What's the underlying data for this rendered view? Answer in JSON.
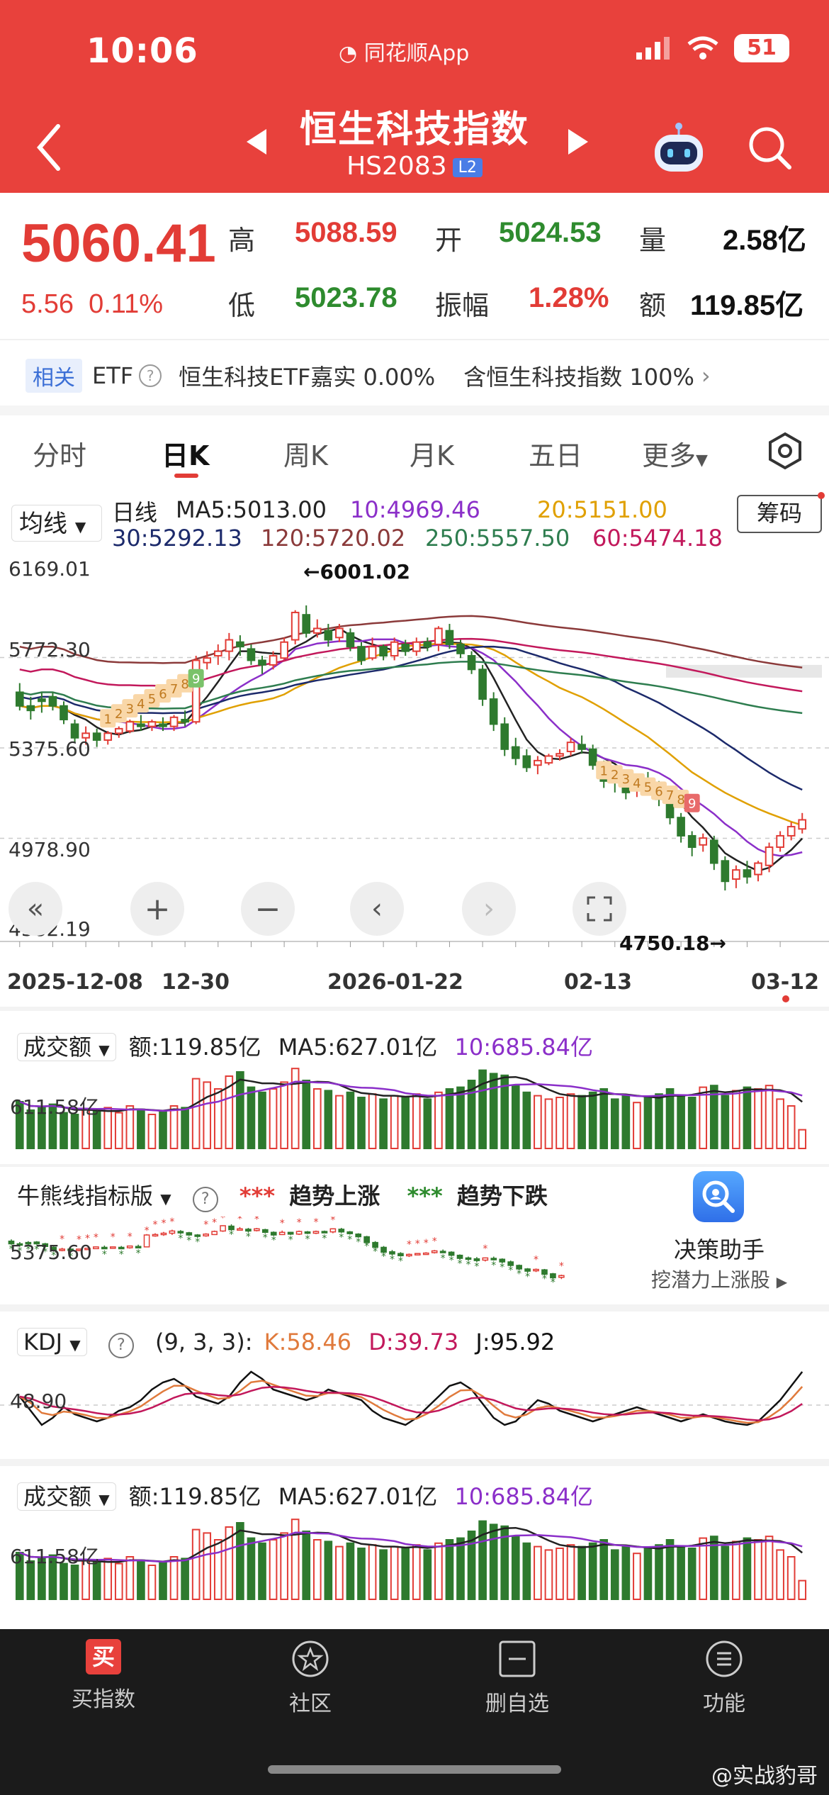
{
  "status": {
    "time": "10:06",
    "app_name": "同花顺App",
    "battery": "51"
  },
  "header": {
    "title": "恒生科技指数",
    "code": "HS2083",
    "badge": "L2"
  },
  "quote": {
    "price": "5060.41",
    "change": "5.56",
    "change_pct": "0.11%",
    "high_label": "高",
    "high": "5088.59",
    "open_label": "开",
    "open": "5024.53",
    "volume_label": "量",
    "volume": "2.58亿",
    "low_label": "低",
    "low": "5023.78",
    "amplitude_label": "振幅",
    "amplitude": "1.28%",
    "amount_label": "额",
    "amount": "119.85亿"
  },
  "related": {
    "tag": "相关",
    "etf": "ETF",
    "text": "恒生科技ETF嘉实 0.00%",
    "index_text": "含恒生科技指数 100%"
  },
  "tabs": [
    "分时",
    "日K",
    "周K",
    "月K",
    "五日",
    "更多"
  ],
  "ma": {
    "select": "均线",
    "period": "日线",
    "ma5": "MA5:5013.00",
    "ma10": "10:4969.46",
    "ma20": "20:5151.00",
    "ma30": "30:5292.13",
    "ma120": "120:5720.02",
    "ma250": "250:5557.50",
    "ma60": "60:5474.18",
    "chip_button": "筹码",
    "colors": {
      "ma5": "#222222",
      "ma10": "#8b2fc9",
      "ma20": "#e0a000",
      "ma30": "#1c2a6b",
      "ma120": "#8b3a3a",
      "ma250": "#2e7d4f",
      "ma60": "#c2185b"
    }
  },
  "price_chart": {
    "y_ticks": [
      "6169.01",
      "5772.30",
      "5375.60",
      "4978.90",
      "4582.19"
    ],
    "max_label": "←6001.02",
    "min_label": "4750.18→",
    "x_ticks": [
      "2025-12-08",
      "12-30",
      "2026-01-22",
      "02-13",
      "03-12"
    ],
    "sequence_numbers": [
      "1",
      "2",
      "3",
      "4",
      "5",
      "6",
      "7",
      "8",
      "9"
    ]
  },
  "volume_panel": {
    "select": "成交额",
    "amount": "额:119.85亿",
    "ma5": "MA5:627.01亿",
    "ma10": "10:685.84亿",
    "y_tick": "611.58亿"
  },
  "bull_bear_panel": {
    "select": "牛熊线指标版",
    "up_marker": "***",
    "up_label": "趋势上涨",
    "down_marker": "***",
    "down_label": "趋势下跌",
    "y_tick": "5375.60",
    "assistant_title": "决策助手",
    "assistant_sub": "挖潜力上涨股"
  },
  "kdj_panel": {
    "select": "KDJ",
    "params": "(9, 3, 3):",
    "k": "K:58.46",
    "d": "D:39.73",
    "j": "J:95.92",
    "y_tick": "48.90"
  },
  "volume_panel2": {
    "select": "成交额",
    "amount": "额:119.85亿",
    "ma5": "MA5:627.01亿",
    "ma10": "10:685.84亿",
    "y_tick": "611.58亿"
  },
  "nav": [
    "买指数",
    "社区",
    "删自选",
    "功能"
  ],
  "nav_icon_text": "买",
  "watermark": "@实战豹哥",
  "candles": [
    [
      5620,
      5660,
      5560,
      5540
    ],
    [
      5560,
      5600,
      5540,
      5500
    ],
    [
      5590,
      5620,
      5580,
      5530
    ],
    [
      5600,
      5620,
      5560,
      5540
    ],
    [
      5560,
      5580,
      5500,
      5480
    ],
    [
      5480,
      5500,
      5420,
      5400
    ],
    [
      5420,
      5470,
      5440,
      5390
    ],
    [
      5440,
      5460,
      5410,
      5380
    ],
    [
      5410,
      5450,
      5440,
      5390
    ],
    [
      5440,
      5470,
      5460,
      5420
    ],
    [
      5450,
      5500,
      5490,
      5440
    ],
    [
      5480,
      5520,
      5470,
      5450
    ],
    [
      5470,
      5500,
      5490,
      5450
    ],
    [
      5480,
      5510,
      5470,
      5450
    ],
    [
      5470,
      5520,
      5510,
      5450
    ],
    [
      5500,
      5540,
      5490,
      5470
    ],
    [
      5490,
      5780,
      5760,
      5480
    ],
    [
      5750,
      5800,
      5770,
      5720
    ],
    [
      5780,
      5830,
      5800,
      5740
    ],
    [
      5800,
      5880,
      5850,
      5760
    ],
    [
      5840,
      5870,
      5820,
      5780
    ],
    [
      5810,
      5830,
      5760,
      5740
    ],
    [
      5760,
      5780,
      5740,
      5700
    ],
    [
      5740,
      5800,
      5780,
      5720
    ],
    [
      5770,
      5860,
      5840,
      5760
    ],
    [
      5850,
      5980,
      5970,
      5830
    ],
    [
      5960,
      6001,
      5880,
      5860
    ],
    [
      5880,
      5940,
      5900,
      5860
    ],
    [
      5890,
      5920,
      5850,
      5820
    ],
    [
      5860,
      5920,
      5900,
      5840
    ],
    [
      5880,
      5900,
      5820,
      5800
    ],
    [
      5820,
      5840,
      5760,
      5740
    ],
    [
      5770,
      5860,
      5820,
      5760
    ],
    [
      5820,
      5830,
      5780,
      5760
    ],
    [
      5780,
      5860,
      5840,
      5760
    ],
    [
      5830,
      5850,
      5800,
      5780
    ],
    [
      5800,
      5860,
      5840,
      5780
    ],
    [
      5840,
      5860,
      5820,
      5800
    ],
    [
      5830,
      5910,
      5900,
      5800
    ],
    [
      5890,
      5920,
      5830,
      5810
    ],
    [
      5830,
      5850,
      5790,
      5770
    ],
    [
      5780,
      5800,
      5720,
      5700
    ],
    [
      5720,
      5740,
      5590,
      5560
    ],
    [
      5590,
      5620,
      5480,
      5450
    ],
    [
      5480,
      5510,
      5370,
      5340
    ],
    [
      5380,
      5420,
      5330,
      5300
    ],
    [
      5340,
      5370,
      5290,
      5270
    ],
    [
      5300,
      5340,
      5320,
      5260
    ],
    [
      5310,
      5350,
      5340,
      5300
    ],
    [
      5340,
      5370,
      5350,
      5320
    ],
    [
      5360,
      5420,
      5400,
      5340
    ],
    [
      5390,
      5430,
      5370,
      5350
    ],
    [
      5370,
      5390,
      5300,
      5280
    ],
    [
      5300,
      5320,
      5230,
      5200
    ],
    [
      5240,
      5270,
      5230,
      5180
    ],
    [
      5220,
      5260,
      5180,
      5150
    ],
    [
      5190,
      5250,
      5240,
      5160
    ],
    [
      5230,
      5270,
      5210,
      5180
    ],
    [
      5210,
      5230,
      5150,
      5120
    ],
    [
      5150,
      5180,
      5070,
      5040
    ],
    [
      5070,
      5090,
      4990,
      4960
    ],
    [
      4990,
      5010,
      4940,
      4900
    ],
    [
      4950,
      5000,
      4980,
      4920
    ],
    [
      4970,
      4990,
      4870,
      4840
    ],
    [
      4880,
      4900,
      4790,
      4750
    ],
    [
      4800,
      4860,
      4840,
      4760
    ],
    [
      4840,
      4880,
      4810,
      4780
    ],
    [
      4820,
      4880,
      4870,
      4790
    ],
    [
      4860,
      4960,
      4940,
      4830
    ],
    [
      4940,
      5010,
      4990,
      4920
    ],
    [
      4990,
      5050,
      5030,
      4970
    ],
    [
      5020,
      5090,
      5060,
      5000
    ]
  ],
  "volumes": [
    0.55,
    0.45,
    0.48,
    0.52,
    0.42,
    0.4,
    0.46,
    0.44,
    0.48,
    0.42,
    0.5,
    0.46,
    0.4,
    0.44,
    0.5,
    0.48,
    0.82,
    0.78,
    0.7,
    0.85,
    0.9,
    0.72,
    0.66,
    0.7,
    0.78,
    0.94,
    0.8,
    0.7,
    0.68,
    0.62,
    0.66,
    0.6,
    0.64,
    0.58,
    0.62,
    0.6,
    0.64,
    0.58,
    0.66,
    0.7,
    0.72,
    0.8,
    0.92,
    0.88,
    0.86,
    0.74,
    0.66,
    0.62,
    0.58,
    0.6,
    0.64,
    0.62,
    0.66,
    0.7,
    0.58,
    0.62,
    0.54,
    0.6,
    0.64,
    0.7,
    0.62,
    0.6,
    0.72,
    0.74,
    0.62,
    0.68,
    0.72,
    0.7,
    0.74,
    0.58,
    0.5,
    0.22
  ]
}
